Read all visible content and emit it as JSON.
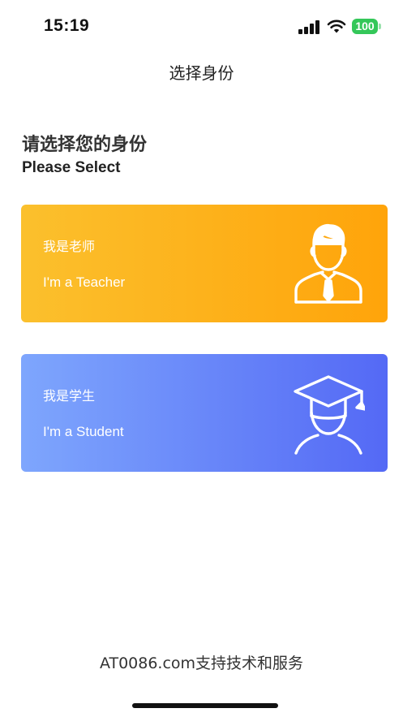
{
  "status_bar": {
    "time": "15:19",
    "battery": "100",
    "icons": [
      "signal-icon",
      "wifi-icon",
      "battery-icon"
    ],
    "battery_color": "#34c759"
  },
  "nav": {
    "title": "选择身份"
  },
  "heading": {
    "title_cn": "请选择您的身份",
    "title_en": "Please Select"
  },
  "cards": [
    {
      "label_cn": "我是老师",
      "label_en": "I'm a Teacher",
      "icon": "teacher-icon",
      "gradient": [
        "#fbc02d",
        "#ffa40a"
      ]
    },
    {
      "label_cn": "我是学生",
      "label_en": "I'm a Student",
      "icon": "student-icon",
      "gradient": [
        "#7ea6fd",
        "#5469f5"
      ]
    }
  ],
  "footer": {
    "text": "AT0086.com支持技术和服务"
  }
}
